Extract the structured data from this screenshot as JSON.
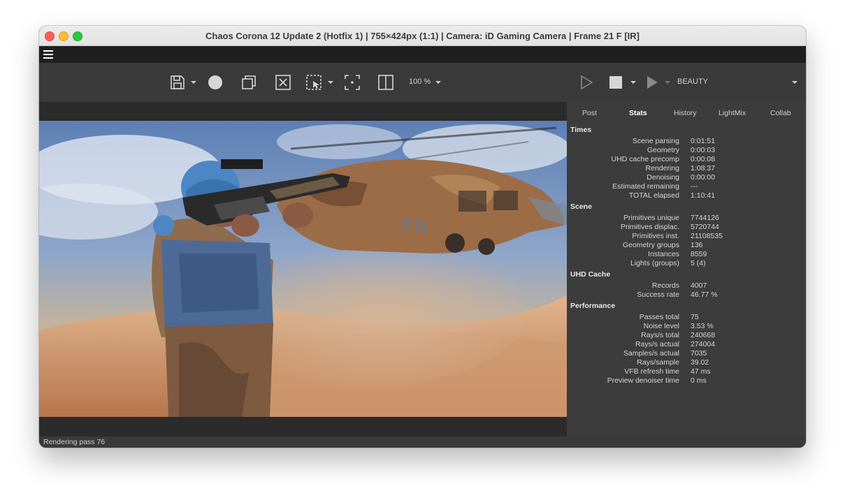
{
  "window": {
    "title": "Chaos Corona 12 Update 2 (Hotfix 1) | 755×424px (1:1) | Camera: iD Gaming Camera | Frame 21 F [IR]"
  },
  "toolbar": {
    "zoom_label": "100 %",
    "channel_label": "BEAUTY",
    "icons": [
      "save-icon",
      "corona-logo-icon",
      "duplicate-icon",
      "clear-icon",
      "region-select-icon",
      "focus-icon",
      "split-view-icon",
      "start-render-icon",
      "stop-render-icon",
      "resume-render-icon"
    ]
  },
  "tabs": [
    "Post",
    "Stats",
    "History",
    "LightMix",
    "Collab"
  ],
  "active_tab": "Stats",
  "stats": {
    "times": {
      "title": "Times",
      "rows": [
        {
          "label": "Scene parsing",
          "value": "0:01:51"
        },
        {
          "label": "Geometry",
          "value": "0:00:03"
        },
        {
          "label": "UHD cache precomp",
          "value": "0:00:08"
        },
        {
          "label": "Rendering",
          "value": "1:08:37"
        },
        {
          "label": "Denoising",
          "value": "0:00:00"
        },
        {
          "label": "Estimated remaining",
          "value": "---"
        },
        {
          "label": "TOTAL elapsed",
          "value": "1:10:41"
        }
      ]
    },
    "scene": {
      "title": "Scene",
      "rows": [
        {
          "label": "Primitives unique",
          "value": "7744126"
        },
        {
          "label": "Primitives displac.",
          "value": "5720744"
        },
        {
          "label": "Primitives inst.",
          "value": "21108535"
        },
        {
          "label": "Geometry groups",
          "value": "136"
        },
        {
          "label": "Instances",
          "value": "8559"
        },
        {
          "label": "Lights (groups)",
          "value": "5 (4)"
        }
      ]
    },
    "uhd": {
      "title": "UHD Cache",
      "rows": [
        {
          "label": "Records",
          "value": "4007"
        },
        {
          "label": "Success rate",
          "value": "46.77 %"
        }
      ]
    },
    "performance": {
      "title": "Performance",
      "rows": [
        {
          "label": "Passes total",
          "value": "75"
        },
        {
          "label": "Noise level",
          "value": "3.53 %"
        },
        {
          "label": "Rays/s total",
          "value": "240668"
        },
        {
          "label": "Rays/s actual",
          "value": "274004"
        },
        {
          "label": "Samples/s actual",
          "value": "7035"
        },
        {
          "label": "Rays/sample",
          "value": "39.02"
        },
        {
          "label": "VFB refresh time",
          "value": "47 ms"
        },
        {
          "label": "Preview denoiser time",
          "value": "0 ms"
        }
      ]
    }
  },
  "status": {
    "text": "Rendering pass 76"
  },
  "colors": {
    "accent": "#4a9cff",
    "background": "#3a3a3a"
  }
}
